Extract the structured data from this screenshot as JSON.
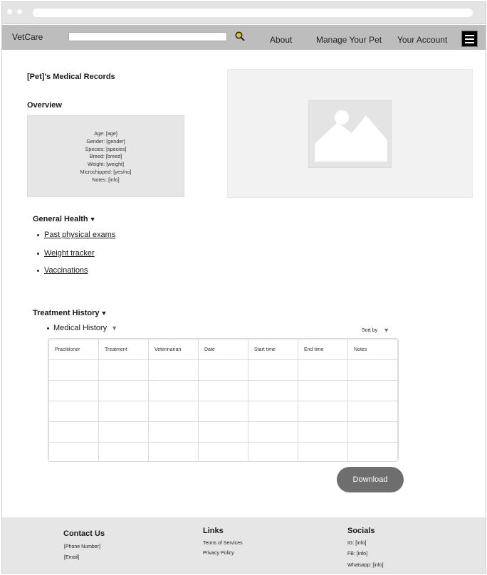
{
  "navbar": {
    "brand": "VetCare",
    "search_placeholder": "",
    "links": [
      "About",
      "Manage Your Pet",
      "Your Account"
    ]
  },
  "records": {
    "title": "[Pet]'s Medical Records",
    "overview_heading": "Overview",
    "overview_lines": [
      "Age: [age]",
      "Gender: [gender]",
      "Species: [species]",
      "Breed: [breed]",
      "Weight: [weight]",
      "Microchipped: [yes/no]",
      "Notes: [info]"
    ]
  },
  "general_health": {
    "heading": "General Health",
    "items": [
      "Past physical exams",
      "Weight tracker",
      "Vaccinations"
    ]
  },
  "treatment_history": {
    "heading": "Treatment History",
    "sub_item": "Medical History",
    "sort_label": "Sort by",
    "columns": [
      "Practitioner",
      "Treatment",
      "Veterinarian",
      "Date",
      "Start time",
      "End time",
      "Notes"
    ],
    "rows": [
      [
        "",
        "",
        "",
        "",
        "",
        "",
        ""
      ],
      [
        "",
        "",
        "",
        "",
        "",
        "",
        ""
      ],
      [
        "",
        "",
        "",
        "",
        "",
        "",
        ""
      ],
      [
        "",
        "",
        "",
        "",
        "",
        "",
        ""
      ],
      [
        "",
        "",
        "",
        "",
        "",
        "",
        ""
      ]
    ],
    "download_label": "Download"
  },
  "footer": {
    "contact": {
      "heading": "Contact Us",
      "phone": "[Phone Number]",
      "email": "[Email]"
    },
    "links": {
      "heading": "Links",
      "items": [
        "Terms of Services",
        "Privacy Policy"
      ]
    },
    "socials": {
      "heading": "Socials",
      "items": [
        "IG: [info]",
        "FB: [info]",
        "Whatsapp: [info]"
      ]
    }
  },
  "colors": {
    "navbar_bg": "#bdbdbd",
    "footer_bg": "#e6e6e6",
    "button_bg": "#6e6e6e",
    "search_icon": "#c8a200"
  },
  "icons": [
    "search-icon",
    "menu-icon",
    "image-placeholder-icon",
    "triangle-down-icon"
  ]
}
